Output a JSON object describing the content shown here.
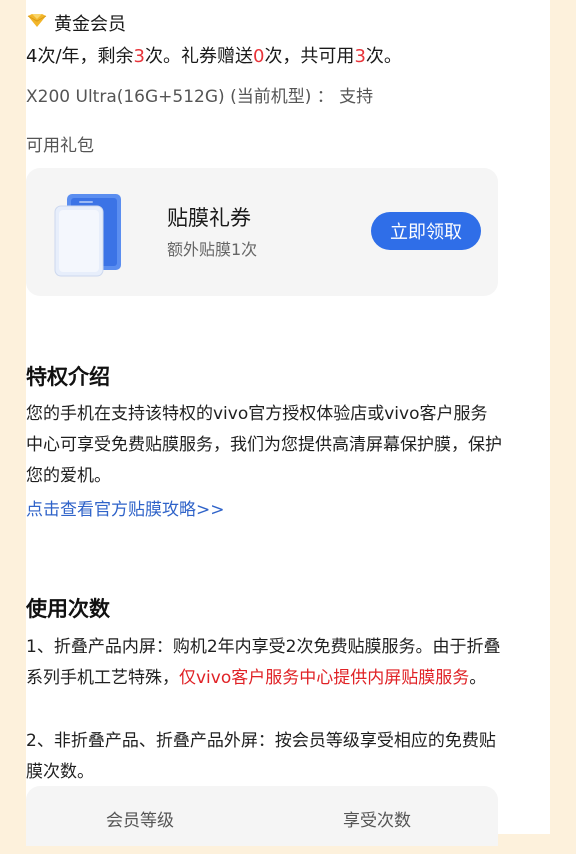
{
  "member": {
    "title": "黄金会员",
    "quota_a": "4次/年，剩余",
    "remain": "3",
    "quota_b": "次。礼券赠送",
    "gift": "0",
    "quota_c": "次，共可用",
    "total": "3",
    "quota_d": "次。",
    "model_line": "X200 Ultra(16G+512G) (当前机型) ： 支持"
  },
  "gift_pack": {
    "label": "可用礼包",
    "card_title": "贴膜礼券",
    "card_sub": "额外贴膜1次",
    "button": "立即领取"
  },
  "privilege": {
    "heading": "特权介绍",
    "body": "您的手机在支持该特权的vivo官方授权体验店或vivo客户服务中心可享受免费贴膜服务，我们为您提供高清屏幕保护膜，保护您的爱机。",
    "link": "点击查看官方贴膜攻略>>"
  },
  "usage": {
    "heading": "使用次数",
    "p1_a": "1、折叠产品内屏：购机2年内享受2次免费贴膜服务。由于折叠系列手机工艺特殊，",
    "p1_red": "仅vivo客户服务中心提供内屏贴膜服务",
    "p1_b": "。",
    "p2": "2、非折叠产品、折叠产品外屏：按会员等级享受相应的免费贴膜次数。",
    "table_headers": [
      "会员等级",
      "享受次数"
    ]
  },
  "colors": {
    "accent_blue": "#2f6ee8",
    "highlight_red": "#e8343a",
    "page_bg": "#fdf1dc"
  },
  "icons": [
    "gold-member-icon",
    "screen-protector-icon"
  ]
}
